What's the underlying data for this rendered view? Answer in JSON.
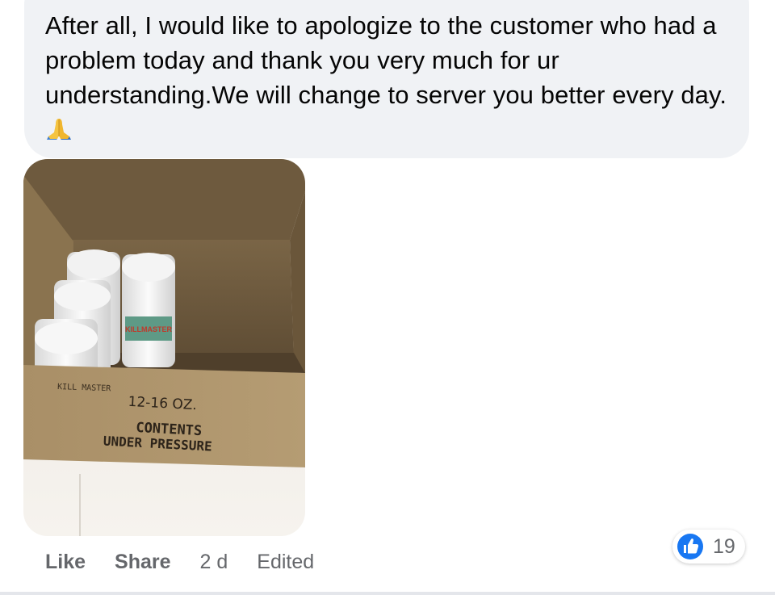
{
  "comment": {
    "text": "After all, I would like to apologize to the customer who had a problem today and thank you very much for ur understanding.We will change to server you better every day.",
    "emoji": "folded-hands-emoji"
  },
  "photo": {
    "box_print": {
      "brand": "KILL MASTER",
      "size": "12-16 OZ.",
      "line1": "CONTENTS",
      "line2": "UNDER PRESSURE",
      "can_label": "KILLMASTER"
    }
  },
  "actions": {
    "like_label": "Like",
    "share_label": "Share",
    "time": "2 d",
    "edited": "Edited"
  },
  "reactions": {
    "type": "like-icon",
    "count": "19",
    "color": "#1877f2"
  }
}
